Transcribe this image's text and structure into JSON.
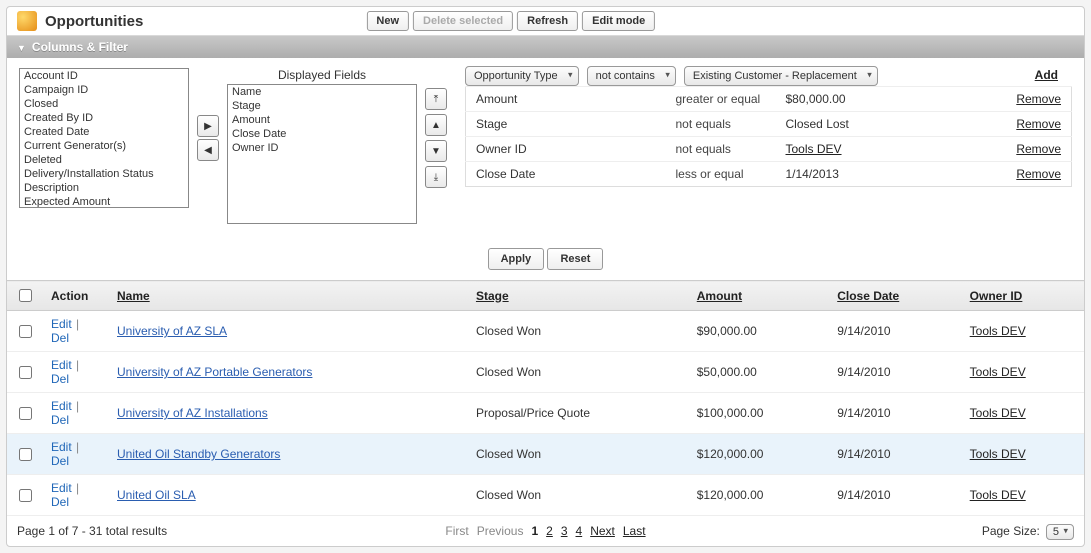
{
  "header": {
    "title": "Opportunities",
    "buttons": {
      "new": "New",
      "delete": "Delete selected",
      "refresh": "Refresh",
      "editmode": "Edit mode"
    }
  },
  "columns_filter_label": "Columns & Filter",
  "available_fields": [
    "Account ID",
    "Campaign ID",
    "Closed",
    "Created By ID",
    "Created Date",
    "Current Generator(s)",
    "Deleted",
    "Delivery/Installation Status",
    "Description",
    "Expected Amount"
  ],
  "displayed_label": "Displayed Fields",
  "displayed_fields": [
    "Name",
    "Stage",
    "Amount",
    "Close Date",
    "Owner ID"
  ],
  "filter_new": {
    "field": "Opportunity Type",
    "op": "not contains",
    "value": "Existing Customer - Replacement",
    "add": "Add"
  },
  "filters": [
    {
      "field": "Amount",
      "op": "greater or equal",
      "value": "$80,000.00",
      "value_link": false
    },
    {
      "field": "Stage",
      "op": "not equals",
      "value": "Closed Lost",
      "value_link": false
    },
    {
      "field": "Owner ID",
      "op": "not equals",
      "value": "Tools DEV",
      "value_link": true
    },
    {
      "field": "Close Date",
      "op": "less or equal",
      "value": "1/14/2013",
      "value_link": false
    }
  ],
  "filter_remove_label": "Remove",
  "apply_buttons": {
    "apply": "Apply",
    "reset": "Reset"
  },
  "grid": {
    "headers": {
      "action": "Action",
      "name": "Name",
      "stage": "Stage",
      "amount": "Amount",
      "close": "Close Date",
      "owner": "Owner ID"
    },
    "action_labels": {
      "edit": "Edit",
      "del": "Del"
    },
    "rows": [
      {
        "name": "University of AZ SLA",
        "stage": "Closed Won",
        "amount": "$90,000.00",
        "close": "9/14/2010",
        "owner": "Tools DEV",
        "hi": false
      },
      {
        "name": "University of AZ Portable Generators",
        "stage": "Closed Won",
        "amount": "$50,000.00",
        "close": "9/14/2010",
        "owner": "Tools DEV",
        "hi": false
      },
      {
        "name": "University of AZ Installations",
        "stage": "Proposal/Price Quote",
        "amount": "$100,000.00",
        "close": "9/14/2010",
        "owner": "Tools DEV",
        "hi": false
      },
      {
        "name": "United Oil Standby Generators",
        "stage": "Closed Won",
        "amount": "$120,000.00",
        "close": "9/14/2010",
        "owner": "Tools DEV",
        "hi": true
      },
      {
        "name": "United Oil SLA",
        "stage": "Closed Won",
        "amount": "$120,000.00",
        "close": "9/14/2010",
        "owner": "Tools DEV",
        "hi": false
      }
    ]
  },
  "footer": {
    "summary": "Page 1 of 7 - 31 total results",
    "first": "First",
    "prev": "Previous",
    "next": "Next",
    "last": "Last",
    "pages": [
      "1",
      "2",
      "3",
      "4"
    ],
    "page_size_label": "Page Size:",
    "page_size": "5"
  }
}
